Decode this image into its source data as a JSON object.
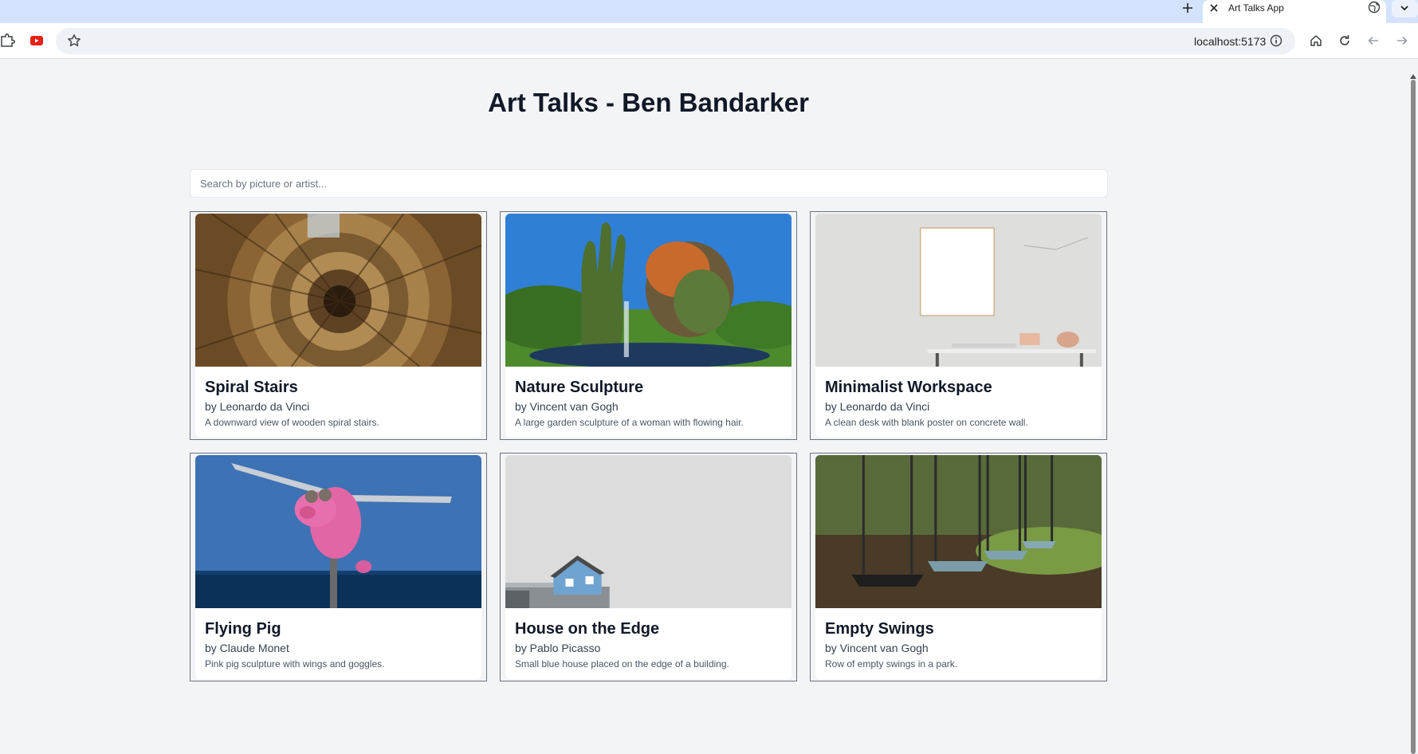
{
  "browser": {
    "tab_title": "Art Talks App",
    "url": "localhost:5173",
    "icons": {
      "new_tab": "plus-icon",
      "close_tab": "close-icon",
      "tab_menu": "chevron-down-icon",
      "extensions": "puzzle-icon",
      "youtube": "youtube-icon",
      "bookmark": "star-icon",
      "site_info": "info-icon",
      "home": "home-icon",
      "reload": "reload-icon",
      "back": "back-arrow-icon",
      "forward": "forward-arrow-icon"
    }
  },
  "page": {
    "title": "Art Talks - Ben Bandarker",
    "search": {
      "placeholder": "Search by picture or artist...",
      "value": ""
    },
    "cards": [
      {
        "title": "Spiral Stairs",
        "artist": "by Leonardo da Vinci",
        "description": "A downward view of wooden spiral stairs.",
        "image": "spiral-stairs-image"
      },
      {
        "title": "Nature Sculpture",
        "artist": "by Vincent van Gogh",
        "description": "A large garden sculpture of a woman with flowing hair.",
        "image": "nature-sculpture-image"
      },
      {
        "title": "Minimalist Workspace",
        "artist": "by Leonardo da Vinci",
        "description": "A clean desk with blank poster on concrete wall.",
        "image": "minimalist-workspace-image"
      },
      {
        "title": "Flying Pig",
        "artist": "by Claude Monet",
        "description": "Pink pig sculpture with wings and goggles.",
        "image": "flying-pig-image"
      },
      {
        "title": "House on the Edge",
        "artist": "by Pablo Picasso",
        "description": "Small blue house placed on the edge of a building.",
        "image": "house-on-edge-image"
      },
      {
        "title": "Empty Swings",
        "artist": "by Vincent van Gogh",
        "description": "Row of empty swings in a park.",
        "image": "empty-swings-image"
      }
    ]
  },
  "colors": {
    "page_background": "#f3f4f6",
    "tabstrip": "#d3e3fd",
    "title_text": "#111827",
    "card_border": "#6b7280"
  }
}
